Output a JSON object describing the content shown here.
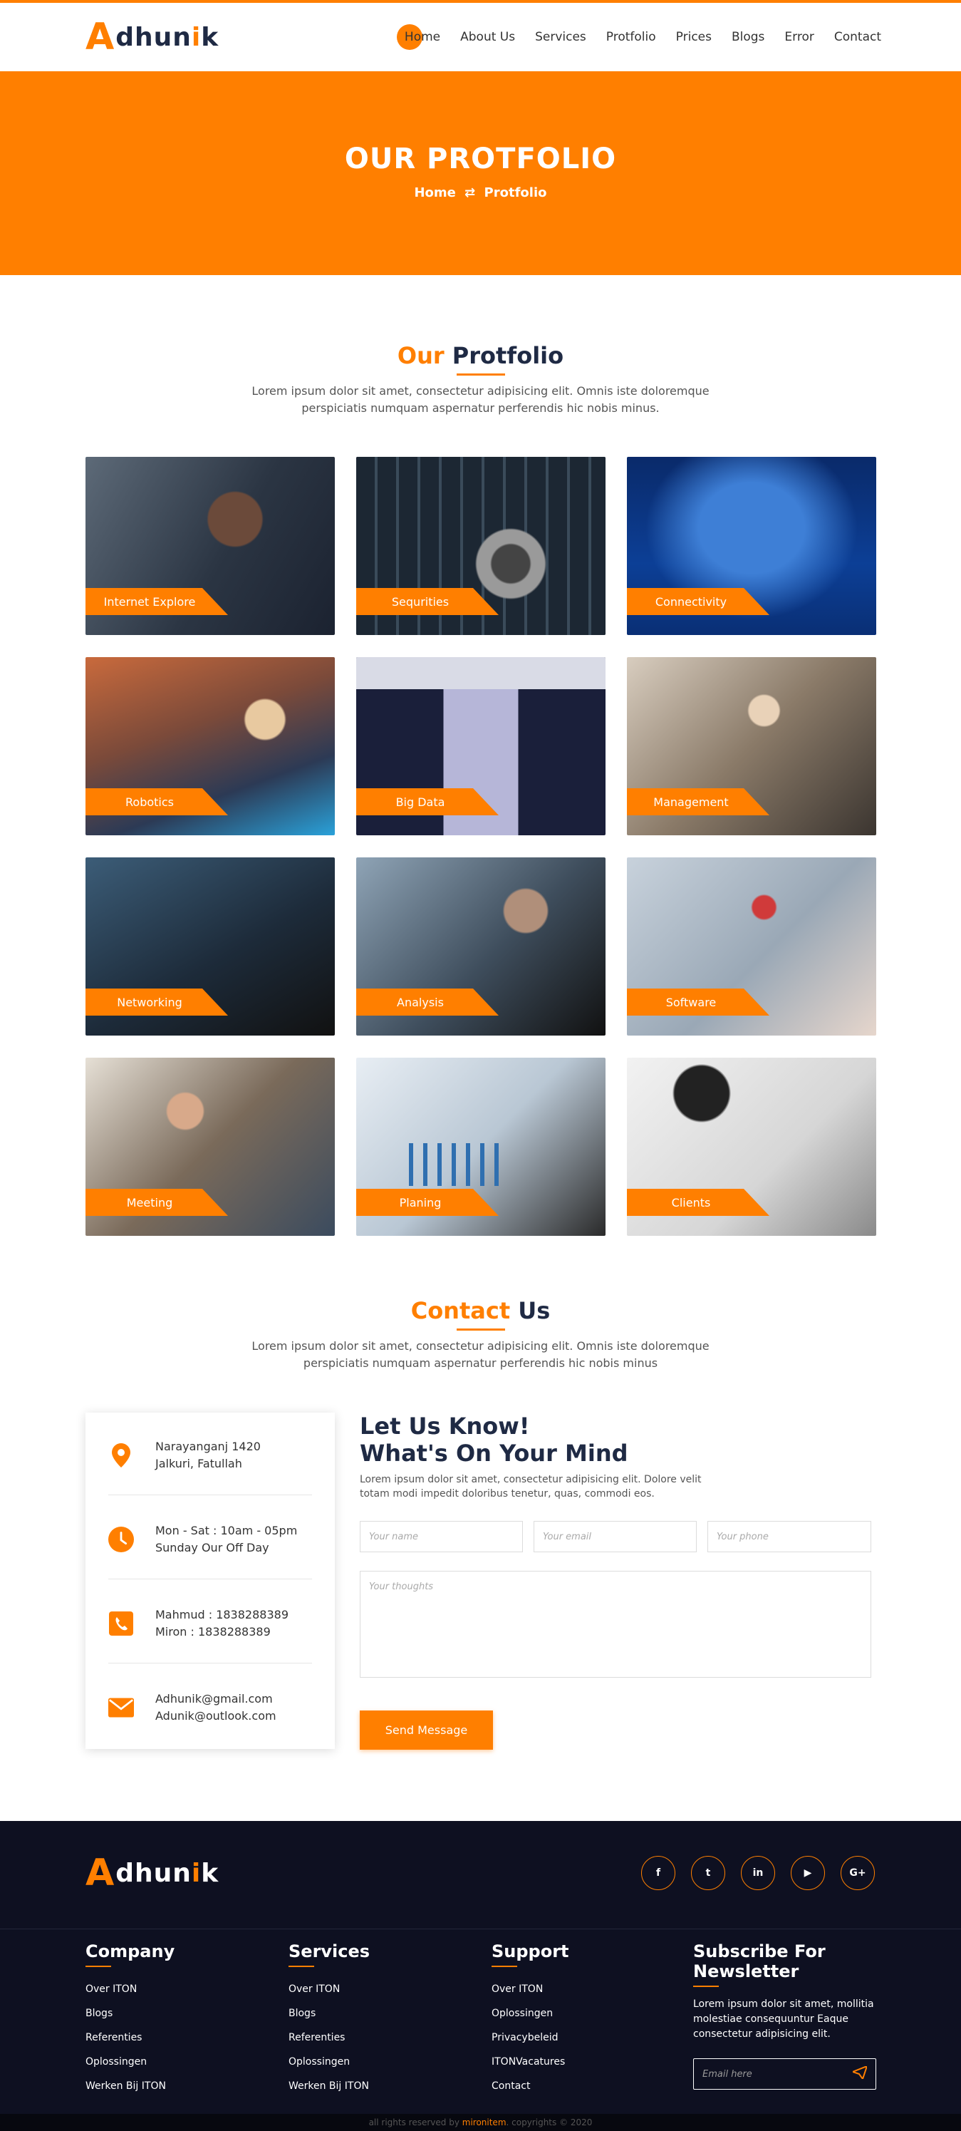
{
  "brand": {
    "logo_a": "A",
    "logo_rest": "dhun",
    "logo_i": "i",
    "logo_k": "k"
  },
  "nav": [
    "Home",
    "About Us",
    "Services",
    "Protfolio",
    "Prices",
    "Blogs",
    "Error",
    "Contact"
  ],
  "banner": {
    "title": "OUR PROTFOLIO",
    "crumb_home": "Home",
    "crumb_sep": "⇄",
    "crumb_current": "Protfolio"
  },
  "portfolio": {
    "title_accent": "Our",
    "title_rest": "Protfolio",
    "description": "Lorem ipsum dolor sit amet, consectetur adipisicing elit. Omnis iste doloremque perspiciatis numquam aspernatur perferendis hic nobis minus.",
    "items": [
      "Internet Explore",
      "Sequrities",
      "Connectivity",
      "Robotics",
      "Big Data",
      "Management",
      "Networking",
      "Analysis",
      "Software",
      "Meeting",
      "Planing",
      "Clients"
    ]
  },
  "contact": {
    "title_accent": "Contact",
    "title_rest": "Us",
    "description": "Lorem ipsum dolor sit amet, consectetur adipisicing elit. Omnis iste doloremque perspiciatis numquam aspernatur perferendis hic nobis minus",
    "address_1": "Narayanganj 1420",
    "address_2": "Jalkuri, Fatullah",
    "hours_1": "Mon - Sat : 10am - 05pm",
    "hours_2": "Sunday Our Off Day",
    "phone_1": "Mahmud : 1838288389",
    "phone_2": "Miron : 1838288389",
    "email_1": "Adhunik@gmail.com",
    "email_2": "Adunik@outlook.com",
    "form_title_1": "Let Us Know!",
    "form_title_2": "What's On Your Mind",
    "form_text": "Lorem ipsum dolor sit amet, consectetur adipisicing elit. Dolore velit totam modi impedit doloribus tenetur, quas, commodi eos.",
    "name_placeholder": "Your name",
    "email_placeholder": "Your email",
    "phone_placeholder": "Your phone",
    "message_placeholder": "Your thoughts",
    "submit_label": "Send Message"
  },
  "footer": {
    "social": [
      "f",
      "t",
      "in",
      "▶",
      "G+"
    ],
    "company": {
      "title": "Company",
      "links": [
        "Over ITON",
        "Blogs",
        "Referenties",
        "Oplossingen",
        "Werken Bij ITON"
      ]
    },
    "services": {
      "title": "Services",
      "links": [
        "Over ITON",
        "Blogs",
        "Referenties",
        "Oplossingen",
        "Werken Bij ITON"
      ]
    },
    "support": {
      "title": "Support",
      "links": [
        "Over ITON",
        "Oplossingen",
        "Privacybeleid",
        "ITONVacatures",
        "Contact"
      ]
    },
    "newsletter": {
      "title_1": "Subscribe For",
      "title_2": "Newsletter",
      "text": "Lorem ipsum dolor sit amet, mollitia molestiae consequuntur Eaque consectetur adipisicing elit.",
      "placeholder": "Email here"
    },
    "copy_pre": "all rights reserved by",
    "copy_brand": "mironitem",
    "copy_post": ". copyrights © 2020"
  },
  "colors": {
    "accent": "#ff7f00",
    "dark": "#1f2a44",
    "footer_bg": "#0e1021"
  }
}
